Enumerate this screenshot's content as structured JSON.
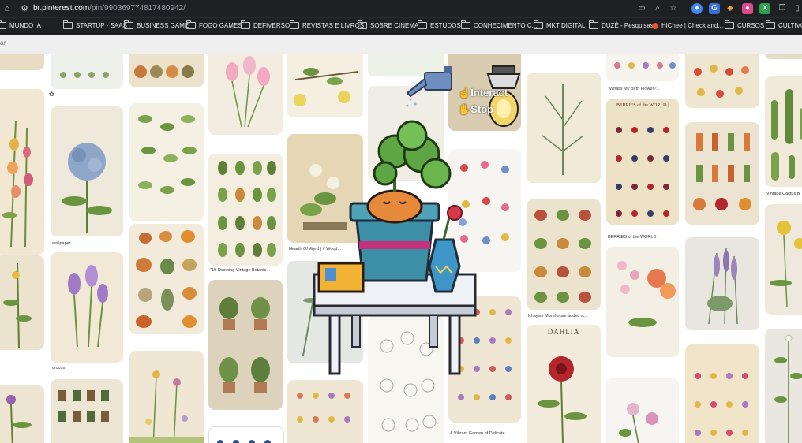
{
  "browser": {
    "url_host": "br.pinterest.com",
    "url_path": "/pin/990369774817480942/",
    "bookmarks": [
      {
        "label": "MUNDO IA",
        "icon": "folder-icon"
      },
      {
        "label": "STARTUP - SAAS",
        "icon": "folder-icon"
      },
      {
        "label": "BUSINESS GAME",
        "icon": "folder-icon"
      },
      {
        "label": "FOGO GAMES",
        "icon": "folder-icon"
      },
      {
        "label": "DEFIVERSO",
        "icon": "folder-icon"
      },
      {
        "label": "REVISTAS E LIVROS",
        "icon": "folder-icon"
      },
      {
        "label": "SOBRE CINEMA",
        "icon": "folder-icon"
      },
      {
        "label": "ESTUDOS",
        "icon": "folder-icon"
      },
      {
        "label": "CONHECIMENTO C...",
        "icon": "folder-icon"
      },
      {
        "label": "MKT DIGITAL",
        "icon": "folder-icon"
      },
      {
        "label": "DUZÊ - Pesquisas",
        "icon": "folder-icon"
      },
      {
        "label": "HiChee | Check and...",
        "icon": "hichee-icon"
      },
      {
        "label": "CURSOS",
        "icon": "folder-icon"
      },
      {
        "label": "CULTIVO",
        "icon": "folder-icon"
      }
    ],
    "search_placeholder": "ar"
  },
  "pins": {
    "col1": {
      "c1": "recreation",
      "c2": "wallpaper",
      "c3": "crocus"
    },
    "col3": {
      "c1": "\"10 Stunning Vintage Botanic...",
      "c2": "Hearth Of Wyrd | # Wood..."
    },
    "col5": {
      "c1": "Khayise Morehouse added a...",
      "c2": "A Vibrant Garden of Delicate...",
      "c3": "DAHLIA"
    },
    "col6": {
      "c1": "\"What's My Birth Flower?...",
      "c2": "BERRIES of the WORLD |"
    },
    "col7": {
      "c1": "Vintage Cactus B"
    }
  },
  "overlay": {
    "interact_label": "Interact",
    "stop_label": "Stop"
  },
  "colors": {
    "chrome_bg": "#1f2023",
    "pot": "#3c8fa6",
    "pot_stripe": "#c2327a",
    "table": "#e9edf1",
    "plant": "#5ea644"
  }
}
